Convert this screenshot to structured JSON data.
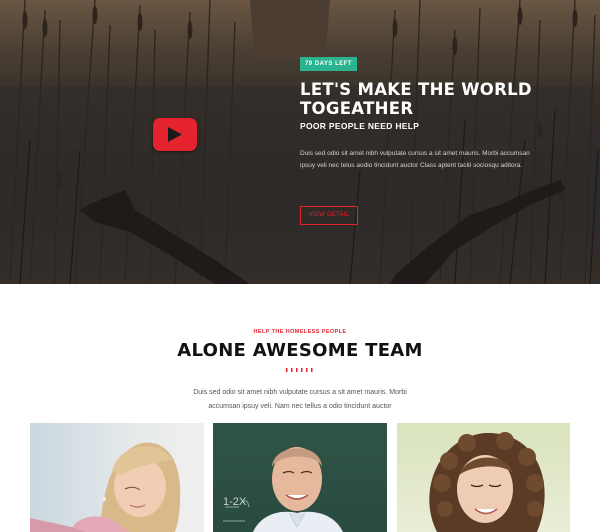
{
  "hero": {
    "badge": "79 DAYS LEFT",
    "title": "LET'S MAKE THE WORLD TOGEATHER",
    "subtitle": "POOR PEOPLE NEED HELP",
    "description": "Duis sed odio sit amet nibh vulputate cursus a sit amet mauris. Morbi accumsan ipsuy veli nec telus aodio tincidunt auctor Class aptent taciti sociosqu aditora.",
    "button_label": "VIEW DETAIL",
    "play_icon": "play-icon",
    "colors": {
      "accent": "#e4232f",
      "badge": "#2bb38f"
    }
  },
  "team_section": {
    "kicker": "HELP THE HOMELESS PEOPLE",
    "title": "ALONE AWESOME TEAM",
    "description_line1": "Duis sed odio sit amet nibh vulputate cursus a sit amet mauris. Morbi",
    "description_line2": "accumsan ipsuy veli. Nam nec tellus a odio tincidunt auctor",
    "members": [
      {
        "photo": "woman-writing-photo"
      },
      {
        "photo": "man-at-chalkboard-photo",
        "chalk_text": "1-2X"
      },
      {
        "photo": "curly-hair-woman-photo"
      }
    ]
  }
}
